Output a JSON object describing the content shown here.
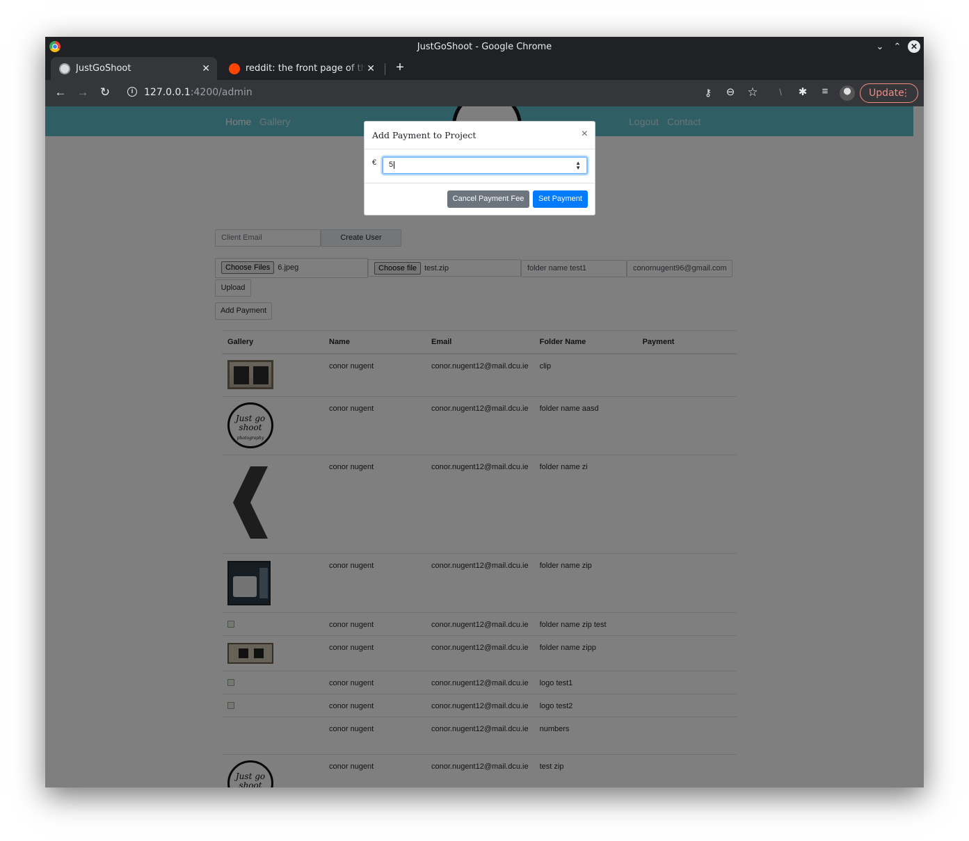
{
  "window": {
    "title": "JustGoShoot - Google Chrome"
  },
  "tabs": [
    {
      "label": "JustGoShoot",
      "active": true
    },
    {
      "label": "reddit: the front page of the internet",
      "active": false
    }
  ],
  "toolbar": {
    "url_host": "127.0.0.1",
    "url_path": ":4200/admin",
    "update_label": "Update"
  },
  "nav": {
    "home": "Home",
    "gallery": "Gallery",
    "logout": "Logout",
    "contact": "Contact"
  },
  "form": {
    "client_email_placeholder": "Client Email",
    "create_user_label": "Create User",
    "choose_files_label": "Choose Files",
    "images_file_name": "6.jpeg",
    "choose_file_label": "Choose file",
    "zip_file_name": "test.zip",
    "folder_name_value": "folder name test1",
    "email_value": "conornugent96@gmail.com",
    "upload_label": "Upload",
    "add_payment_label": "Add Payment"
  },
  "table": {
    "headers": [
      "Gallery",
      "Name",
      "Email",
      "Folder Name",
      "Payment"
    ],
    "rows": [
      {
        "name": "conor nugent",
        "email": "conor.nugent12@mail.dcu.ie",
        "folder": "clip",
        "payment": ""
      },
      {
        "name": "conor nugent",
        "email": "conor.nugent12@mail.dcu.ie",
        "folder": "folder name aasd",
        "payment": ""
      },
      {
        "name": "conor nugent",
        "email": "conor.nugent12@mail.dcu.ie",
        "folder": "folder name zi",
        "payment": ""
      },
      {
        "name": "conor nugent",
        "email": "conor.nugent12@mail.dcu.ie",
        "folder": "folder name zip",
        "payment": ""
      },
      {
        "name": "conor nugent",
        "email": "conor.nugent12@mail.dcu.ie",
        "folder": "folder name zip test",
        "payment": ""
      },
      {
        "name": "conor nugent",
        "email": "conor.nugent12@mail.dcu.ie",
        "folder": "folder name zipp",
        "payment": ""
      },
      {
        "name": "conor nugent",
        "email": "conor.nugent12@mail.dcu.ie",
        "folder": "logo test1",
        "payment": ""
      },
      {
        "name": "conor nugent",
        "email": "conor.nugent12@mail.dcu.ie",
        "folder": "logo test2",
        "payment": ""
      },
      {
        "name": "conor nugent",
        "email": "conor.nugent12@mail.dcu.ie",
        "folder": "numbers",
        "payment": ""
      },
      {
        "name": "conor nugent",
        "email": "conor.nugent12@mail.dcu.ie",
        "folder": "test zip",
        "payment": ""
      }
    ]
  },
  "modal": {
    "title": "Add Payment to Project",
    "close": "×",
    "currency": "€",
    "amount_value": "5",
    "cancel_label": "Cancel Payment Fee",
    "set_label": "Set Payment"
  },
  "logo_text": {
    "line1": "Just go",
    "line2": "shoot",
    "line3": "photography"
  },
  "icons": {
    "back": "back-arrow-icon",
    "forward": "forward-arrow-icon",
    "reload": "reload-icon",
    "key": "key-icon",
    "zoom": "zoom-out-icon",
    "star": "star-icon",
    "extensions": "puzzle-icon",
    "media": "media-controls-icon"
  },
  "colors": {
    "navbar": "#5fbfc8",
    "primary": "#007bff",
    "secondary": "#6c757d",
    "update": "#f28b82"
  }
}
